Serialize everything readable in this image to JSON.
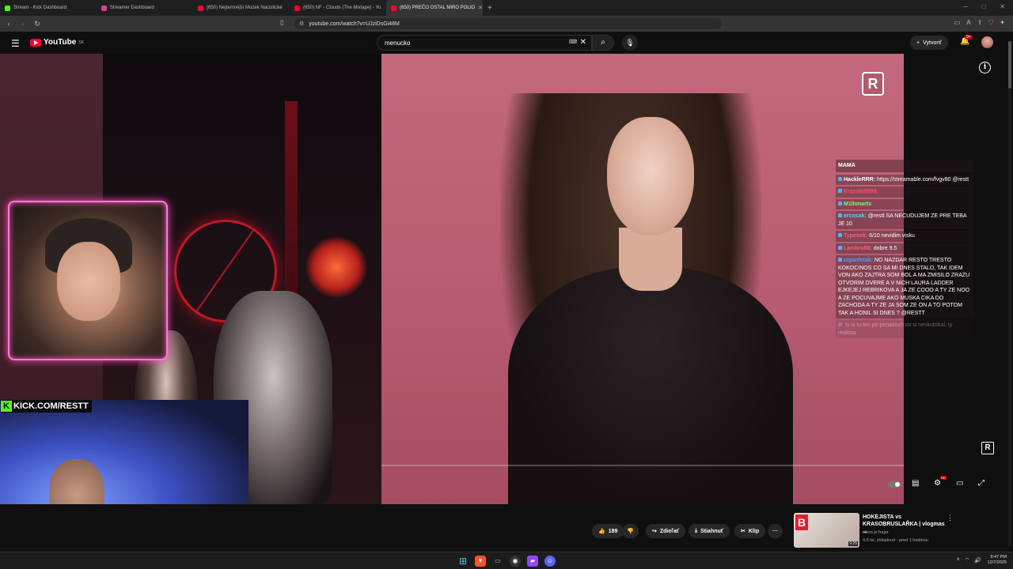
{
  "browser": {
    "tabs": [
      {
        "label": "Stream - Kick Dashboard",
        "color": "#53fc18",
        "active": false
      },
      {
        "label": "Streamer Dashboard",
        "color": "#e0408a",
        "active": false
      },
      {
        "label": "(650) Nejtemnější Mozek Nacistické",
        "color": "#ff0033",
        "active": false
      },
      {
        "label": "(650) NF - Clouds (The Mixtape) - Yo",
        "color": "#ff0033",
        "active": false
      },
      {
        "label": "(650) PREČO OSTAL MIRO POLIO",
        "color": "#ff0033",
        "active": true
      }
    ],
    "new_tab": "+",
    "url": "youtube.com/watch?v=UJziDsGi48M"
  },
  "youtube": {
    "logo_text": "YouTube",
    "logo_region": "SK",
    "search_value": "menucko",
    "create_label": "Vytvoriť",
    "notif_count": "9+"
  },
  "video": {
    "logo_letter": "R",
    "chat": {
      "title": "MAMA",
      "messages": [
        {
          "user": "HackleRRR:",
          "text": "https://streamable.com/fvgv80 @restt",
          "user_color": "#ffffff",
          "faded": false
        },
        {
          "user": "Krazolo9999:",
          "text": "",
          "user_color": "#ff4d6a",
          "faded": false
        },
        {
          "user": "M1llonarts",
          "text": "",
          "user_color": "#7dff7a",
          "faded": false
        },
        {
          "user": "ercosak:",
          "text": "@restt SA NECUDUJEM ZE PRE TEBA JE 10",
          "user_color": "#5fd0ff",
          "faded": false
        },
        {
          "user": "Typesok:",
          "text": "6/10 nevidim visku",
          "user_color": "#ff5a7a",
          "faded": false
        },
        {
          "user": "Lambro88:",
          "text": "dobre 9.5",
          "user_color": "#ff5a7a",
          "faded": false
        },
        {
          "user": "ciganfetak:",
          "text": "NO NAZDAR RESTO TRESTO KOKOCINOS CO SA MI DNES STALO, TAK IDEM VON AKO ZAJTRA SOM BOL A MA ZMISILO ZRAZU OTVORIM DVERE A V NICH LAURA LADDER EJKEJEJ REBRIKOVA A JA ZE COOO A TY ZE NOO A ZE POCUVAJME AKO MUSKA CIKA DO ZACHODA A TY ZE JA SOM ZE ON A TO POTOM TAK A HONIL SI DNES ? @RESTT",
          "user_color": "#4fa0ff",
          "faded": false
        },
        {
          "user": "",
          "text": "ty si tu ten pri penazoch co si neskutrtkal, ty realista",
          "user_color": "#aaaaaa",
          "faded": true
        }
      ]
    },
    "progress_fraction": 0.0
  },
  "overlay": {
    "kick_label": "KICK.COM/RESTT",
    "kick_letter": "K"
  },
  "actions": {
    "like_count": "189",
    "share": "Zdieľať",
    "download": "Stiahnuť",
    "clip": "Klip",
    "more": "···"
  },
  "suggested": {
    "title": "HOKEJISTA vs KRASOBRUSLAŘKA | vlogmas ...",
    "channel": "nikos je frajer",
    "meta": "4,6 tis. zhliadnutí · pred 1 hodinou",
    "duration": "9:25"
  },
  "taskbar": {
    "time": "8:47 PM",
    "date": "12/7/2025"
  },
  "colors": {
    "accent": "#ff0033",
    "kick": "#53fc18",
    "cam_border": "#ff7ad0"
  }
}
